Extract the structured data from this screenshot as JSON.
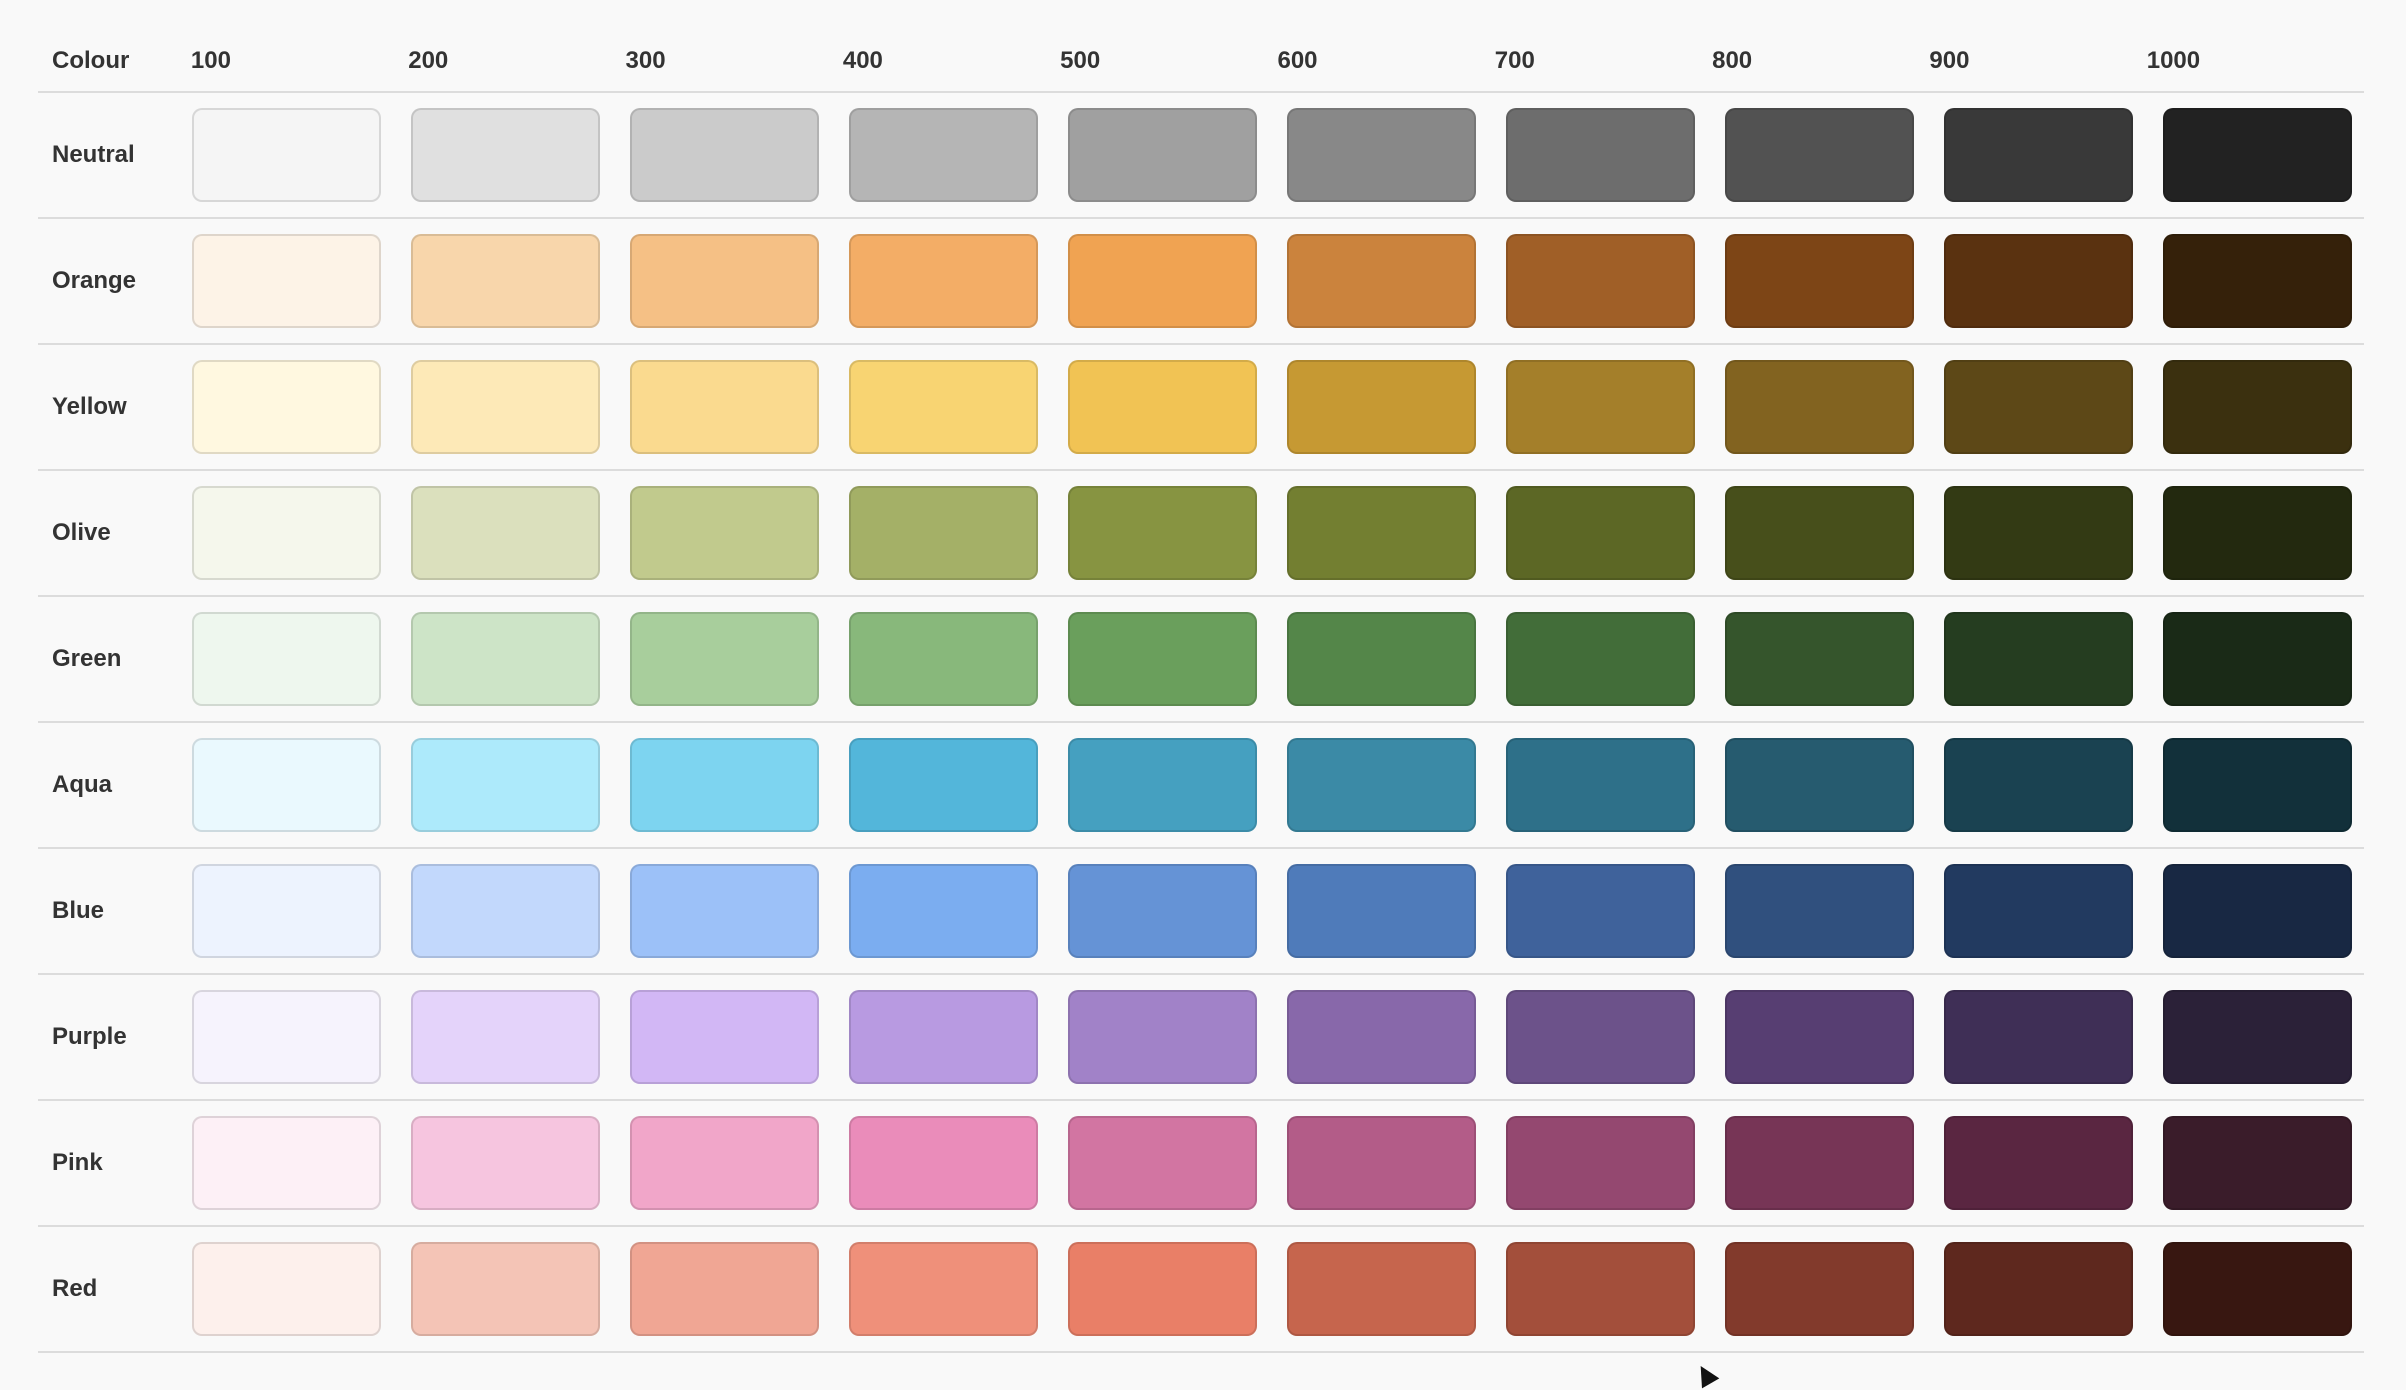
{
  "table": {
    "corner_label": "Colour",
    "shades": [
      "100",
      "200",
      "300",
      "400",
      "500",
      "600",
      "700",
      "800",
      "900",
      "1000"
    ],
    "rows": [
      {
        "name": "Neutral",
        "colors": [
          "#f5f5f5",
          "#e0e0e0",
          "#cbcbcb",
          "#b5b5b5",
          "#a0a0a0",
          "#888888",
          "#6d6d6d",
          "#525252",
          "#393939",
          "#222222"
        ]
      },
      {
        "name": "Orange",
        "colors": [
          "#fdf3e7",
          "#f8d6ab",
          "#f5c085",
          "#f3ad66",
          "#f0a352",
          "#cb833d",
          "#a05f27",
          "#7d4516",
          "#5a3210",
          "#35210a"
        ]
      },
      {
        "name": "Yellow",
        "colors": [
          "#fff8e0",
          "#fde9b7",
          "#fada8f",
          "#f8d472",
          "#f1c354",
          "#c69933",
          "#a47f2a",
          "#826320",
          "#5d4817",
          "#3b300f"
        ]
      },
      {
        "name": "Olive",
        "colors": [
          "#f5f7ec",
          "#dbe0bd",
          "#c1ca8d",
          "#a4b067",
          "#879441",
          "#737f31",
          "#5c6725",
          "#474f1b",
          "#333a14",
          "#23290f"
        ]
      },
      {
        "name": "Green",
        "colors": [
          "#eef7ee",
          "#cde4c7",
          "#a8ce9c",
          "#88b87b",
          "#6a9f5c",
          "#548649",
          "#426d39",
          "#35552c",
          "#253d20",
          "#1a2a17"
        ]
      },
      {
        "name": "Aqua",
        "colors": [
          "#eaf9fe",
          "#adeafb",
          "#7dd4f0",
          "#53b6da",
          "#45a0c0",
          "#3b8aa6",
          "#2e7089",
          "#265b6f",
          "#1a4251",
          "#12303a"
        ]
      },
      {
        "name": "Blue",
        "colors": [
          "#edf3fe",
          "#c2d8fc",
          "#9cc1f8",
          "#7badf0",
          "#6593d6",
          "#4f7bba",
          "#3f629b",
          "#30507e",
          "#223a60",
          "#182843"
        ]
      },
      {
        "name": "Purple",
        "colors": [
          "#f6f3fd",
          "#e4d3fa",
          "#d2b7f5",
          "#b89ae1",
          "#a182c8",
          "#8868aa",
          "#6c528a",
          "#573e72",
          "#3f2f56",
          "#2b2138"
        ]
      },
      {
        "name": "Pink",
        "colors": [
          "#fdf0f6",
          "#f6c5df",
          "#f1a6c9",
          "#ea8cba",
          "#d275a2",
          "#b35c88",
          "#944870",
          "#773556",
          "#5a2641",
          "#3a1c2a"
        ]
      },
      {
        "name": "Red",
        "colors": [
          "#fdf0ec",
          "#f4c4b6",
          "#f0a694",
          "#ef907a",
          "#e97f67",
          "#c6654d",
          "#a34f3b",
          "#823a2c",
          "#5e281e",
          "#381711"
        ]
      }
    ]
  }
}
